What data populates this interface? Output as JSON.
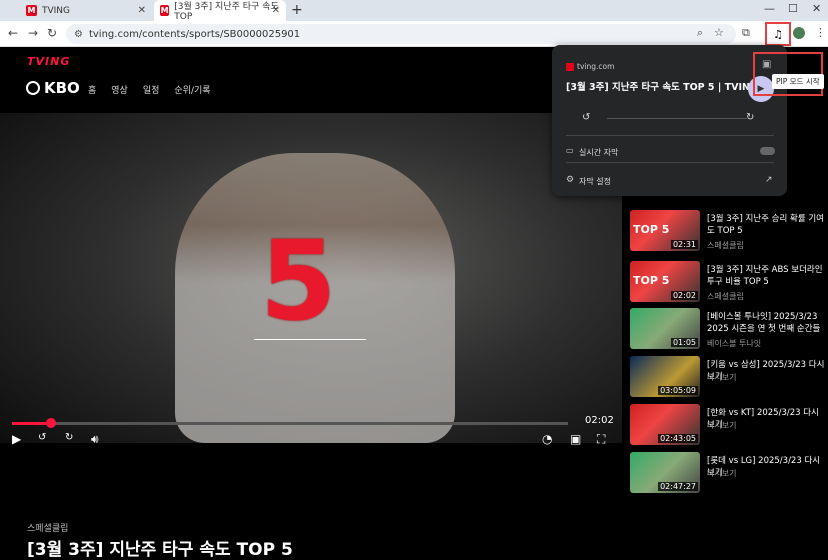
{
  "tabs": [
    {
      "label": "TVING",
      "favicon": "M"
    },
    {
      "label": "[3월 3주] 지난주 타구 속도 TOP",
      "favicon": "M"
    }
  ],
  "new_tab": "+",
  "window_controls": {
    "minimize": "—",
    "maximize": "☐",
    "close": "✕"
  },
  "toolbar": {
    "url": "tving.com/contents/sports/SB0000025901",
    "back": "←",
    "forward": "→",
    "reload": "↻"
  },
  "page": {
    "logo": "TVING",
    "league": "KBO",
    "nav": [
      "홈",
      "영상",
      "일정",
      "순위/기록"
    ],
    "video": {
      "overlay_number": "5",
      "time": "02:02",
      "progress": 0.07,
      "category": "스페셜클립",
      "title": "[3월 3주] 지난주 타구 속도 TOP 5"
    }
  },
  "related": [
    {
      "title": "[3월 3주] 지난주 승리 확률 기여도 TOP 5",
      "sub": "스페셜클립",
      "duration": "02:31",
      "thumb_text": "TOP 5"
    },
    {
      "title": "[3월 3주] 지난주 ABS 보더라인 투구 비율 TOP 5",
      "sub": "스페셜클립",
      "duration": "02:02",
      "thumb_text": "TOP 5"
    },
    {
      "title": "[베이스볼 투나잇] 2025/3/23 2025 시즌을 연 첫 번째 순간들",
      "sub": "베이스볼 투나잇",
      "duration": "01:05",
      "thumb_text": ""
    },
    {
      "title": "[키움 vs 삼성] 2025/3/23 다시보기",
      "sub": "다시보기",
      "duration": "03:05:09",
      "thumb_text": ""
    },
    {
      "title": "[한화 vs KT] 2025/3/23 다시보기",
      "sub": "다시보기",
      "duration": "02:43:05",
      "thumb_text": ""
    },
    {
      "title": "[롯데 vs LG] 2025/3/23 다시보기",
      "sub": "다시보기",
      "duration": "02:47:27",
      "thumb_text": ""
    }
  ],
  "media_popup": {
    "site": "tving.com",
    "title": "[3월 3주] 지난주 타구 속도 TOP 5 | TVING",
    "captions_label": "실시간 자막",
    "settings_label": "자막 설정",
    "pip_tooltip": "PIP 모드 시작"
  }
}
